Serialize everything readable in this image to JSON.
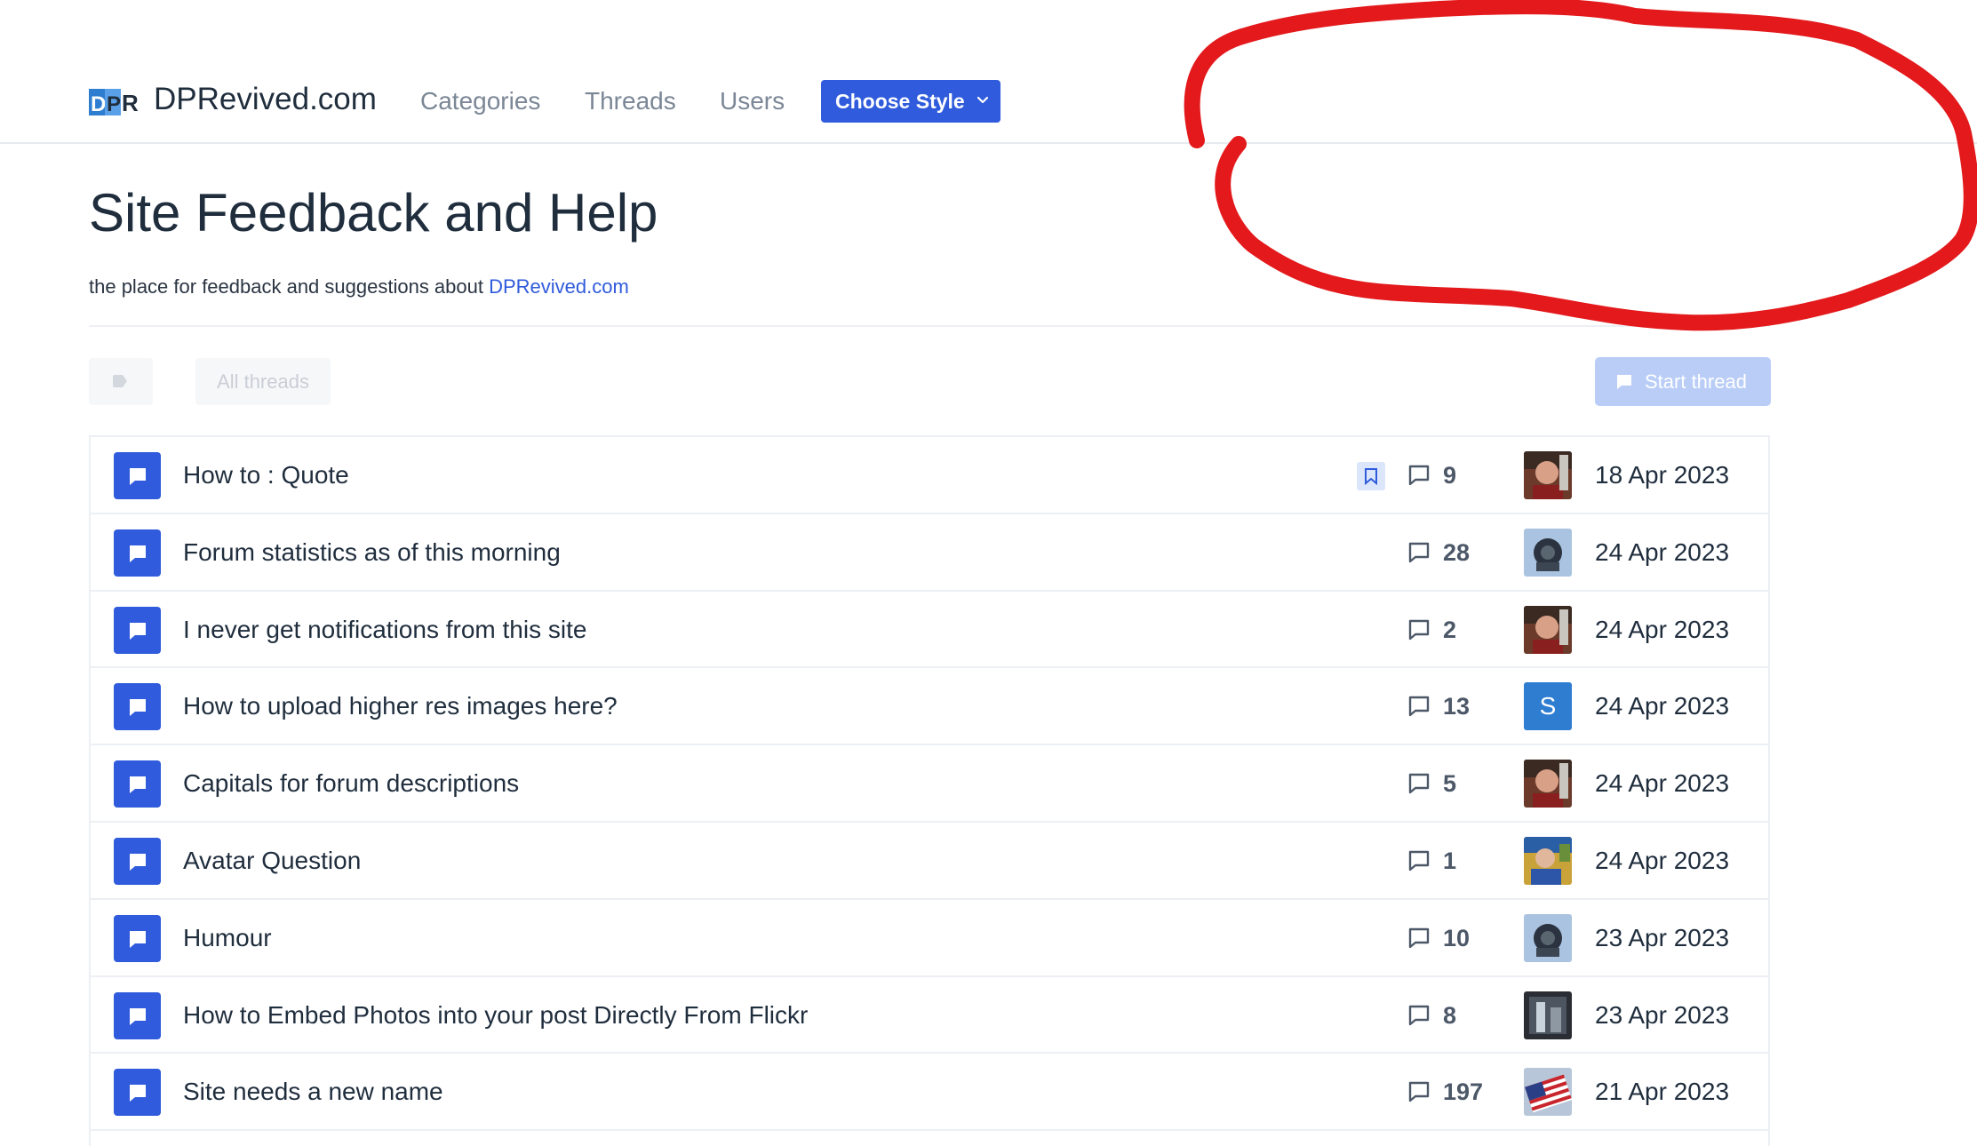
{
  "header": {
    "logo_text": "DPR",
    "site_name": "DPRevived.com",
    "nav": {
      "categories": "Categories",
      "threads": "Threads",
      "users": "Users"
    },
    "choose_style": "Choose Style"
  },
  "page": {
    "title": "Site Feedback and Help",
    "description_prefix": "the place for feedback and suggestions about ",
    "description_link": "DPRevived.com"
  },
  "filters": {
    "all_threads": "All threads",
    "start_thread": "Start thread"
  },
  "threads": [
    {
      "title": "How to : Quote",
      "replies": "9",
      "date": "18 Apr 2023",
      "bookmarked": true,
      "avatar": "photo-man-red"
    },
    {
      "title": "Forum statistics as of this morning",
      "replies": "28",
      "date": "24 Apr 2023",
      "bookmarked": false,
      "avatar": "photo-camera"
    },
    {
      "title": "I never get notifications from this site",
      "replies": "2",
      "date": "24 Apr 2023",
      "bookmarked": false,
      "avatar": "photo-man-red"
    },
    {
      "title": "How to upload higher res images here?",
      "replies": "13",
      "date": "24 Apr 2023",
      "bookmarked": false,
      "avatar": "letter",
      "avatar_letter": "S"
    },
    {
      "title": "Capitals for forum descriptions",
      "replies": "5",
      "date": "24 Apr 2023",
      "bookmarked": false,
      "avatar": "photo-man-red"
    },
    {
      "title": "Avatar Question",
      "replies": "1",
      "date": "24 Apr 2023",
      "bookmarked": false,
      "avatar": "photo-man-blue"
    },
    {
      "title": "Humour",
      "replies": "10",
      "date": "23 Apr 2023",
      "bookmarked": false,
      "avatar": "photo-camera"
    },
    {
      "title": "How to Embed Photos into your post Directly From Flickr",
      "replies": "8",
      "date": "23 Apr 2023",
      "bookmarked": false,
      "avatar": "photo-dark"
    },
    {
      "title": "Site needs a new name",
      "replies": "197",
      "date": "21 Apr 2023",
      "bookmarked": false,
      "avatar": "photo-flag"
    }
  ],
  "colors": {
    "accent": "#2f5bdc",
    "annotation_red": "#e3191c",
    "text": "#1f2d3d",
    "muted": "#7b8796"
  },
  "icons": [
    "chevron-down-icon",
    "tag-icon",
    "chat-bubble-icon",
    "comment-icon",
    "bookmark-icon"
  ]
}
